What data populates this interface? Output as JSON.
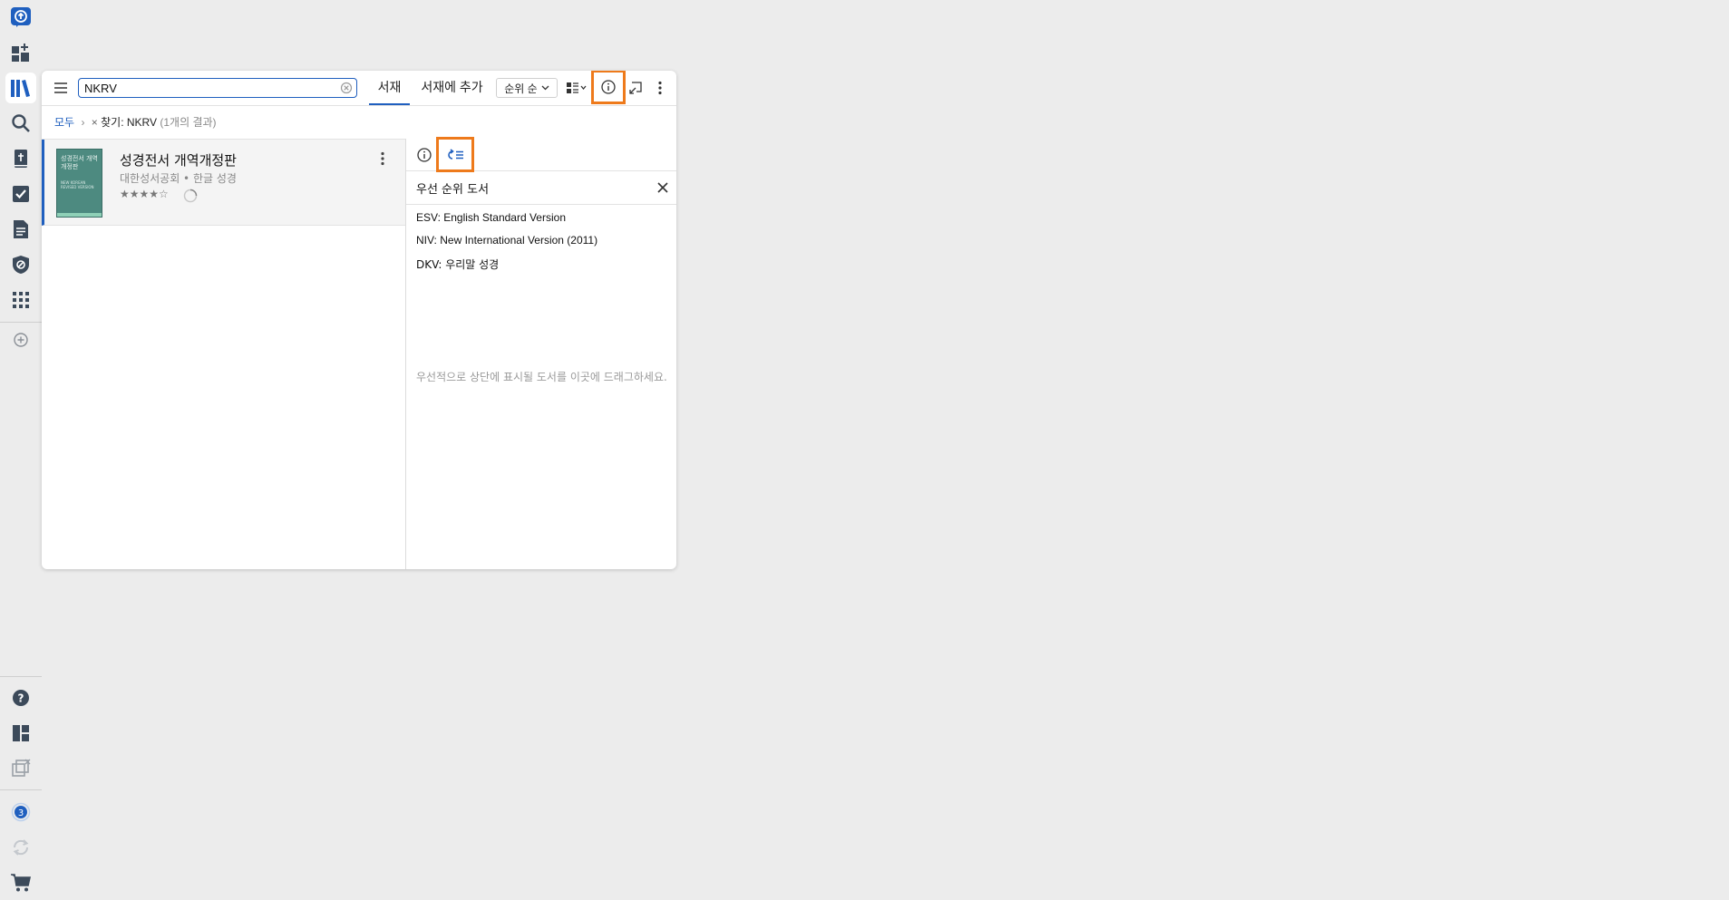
{
  "rail": {
    "top_icons": [
      "upload-icon",
      "add-dashboard-icon",
      "library-icon",
      "search-icon",
      "bible-icon",
      "tasks-icon",
      "document-icon",
      "shield-icon",
      "apps-icon",
      "add-icon"
    ],
    "bottom_icons": [
      "help-icon",
      "layout-icon",
      "detach-icon",
      "notification-count-icon",
      "sync-icon",
      "cart-icon"
    ],
    "notification_count": "3"
  },
  "toolbar": {
    "search_value": "NKRV",
    "tabs": [
      {
        "label": "서재",
        "active": true
      },
      {
        "label": "서재에 추가",
        "active": false
      }
    ],
    "sort_label": "순위 순"
  },
  "breadcrumb": {
    "all": "모두",
    "filter": "찾기: NKRV",
    "count": "(1개의 결과)"
  },
  "results": [
    {
      "title": "성경전서 개역개정판",
      "meta": "대한성서공회 • 한글 성경",
      "stars": "★★★★☆",
      "cover_title": "성경전서 개역개정판",
      "cover_sub": "NEW KOREAN REVISED VERSION"
    }
  ],
  "side_panel": {
    "title": "우선 순위 도서",
    "items": [
      "ESV: English Standard Version",
      "NIV: New International Version (2011)",
      "DKV: 우리말 성경"
    ],
    "drop_hint": "우선적으로 상단에 표시될 도서를 이곳에 드래그하세요."
  },
  "colors": {
    "accent": "#1f5fbf",
    "highlight": "#ee7a1b",
    "background": "#ececec",
    "cover": "#4d8a80"
  }
}
